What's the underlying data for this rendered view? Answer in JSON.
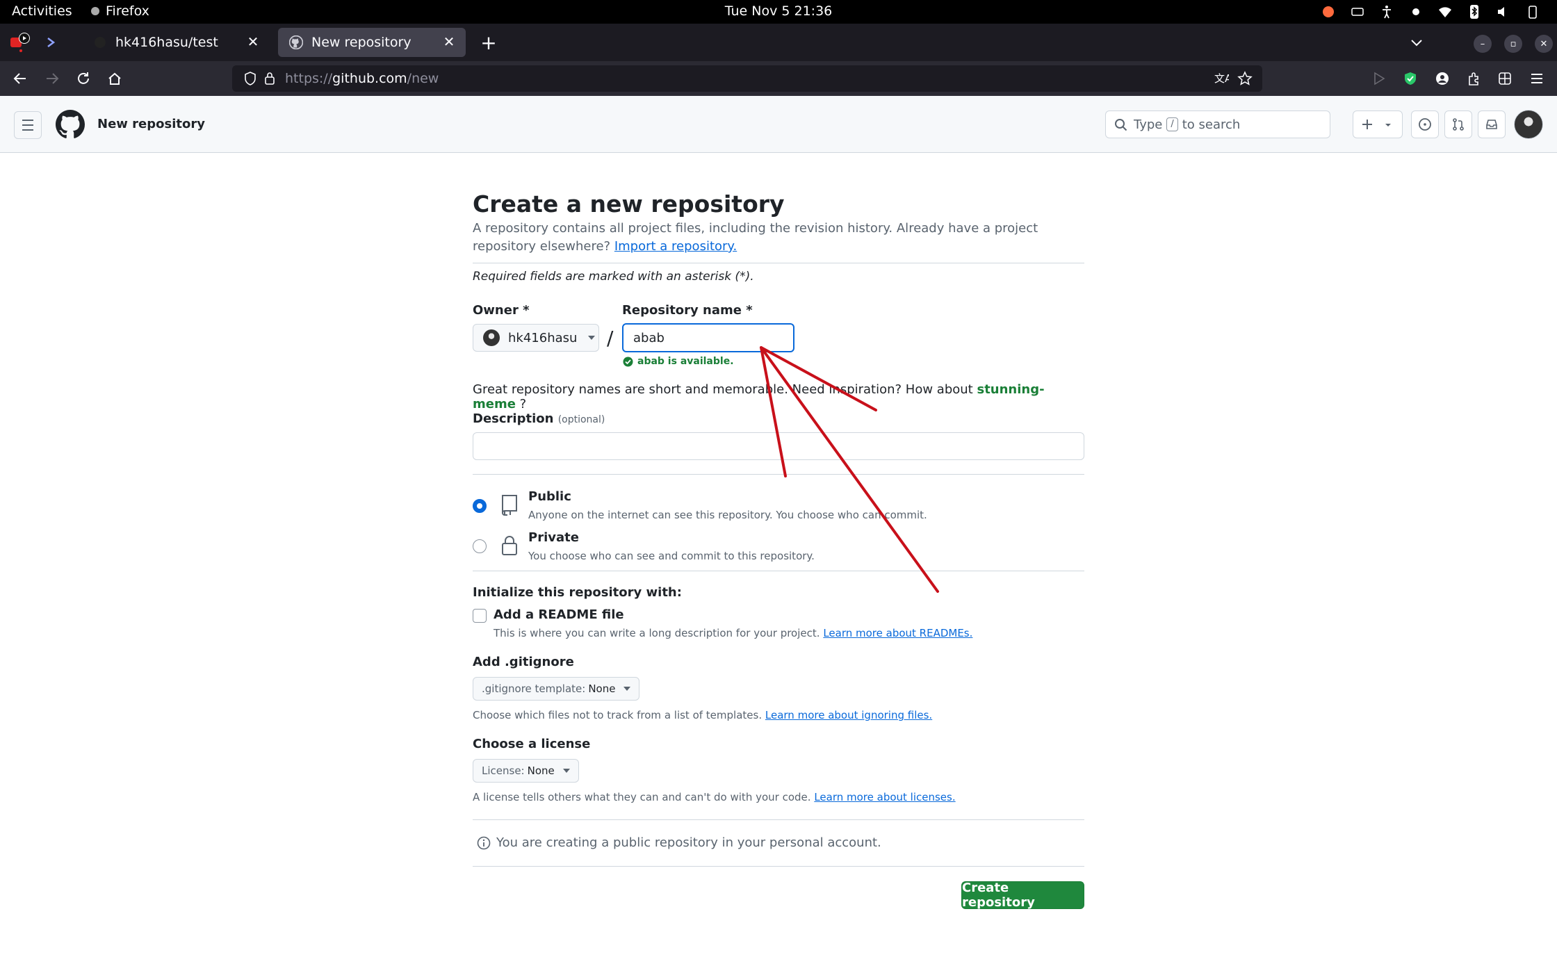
{
  "os_topbar": {
    "activities": "Activities",
    "app_name": "Firefox",
    "clock": "Tue Nov 5  21:36"
  },
  "browser": {
    "tabs": [
      {
        "title": "hk416hasu/test",
        "active": false
      },
      {
        "title": "New repository",
        "active": true
      }
    ],
    "url_prefix": "https://",
    "url_host": "github.com",
    "url_path": "/new"
  },
  "github_header": {
    "page_label": "New repository",
    "search_prefix": "Type",
    "search_key": "/",
    "search_suffix": "to search"
  },
  "form": {
    "title": "Create a new repository",
    "intro": "A repository contains all project files, including the revision history. Already have a project repository elsewhere?",
    "import_link": "Import a repository.",
    "required_note": "Required fields are marked with an asterisk (*).",
    "owner_label": "Owner *",
    "owner_value": "hk416hasu",
    "slash": "/",
    "repo_name_label": "Repository name *",
    "repo_name_value": "abab",
    "availability": "abab is available.",
    "suggestion_prefix": "Great repository names are short and memorable. Need inspiration? How about",
    "suggestion_name": "stunning-meme",
    "suggestion_suffix": "?",
    "description_label": "Description",
    "description_optional": "(optional)",
    "description_value": "",
    "visibility": {
      "public_title": "Public",
      "public_desc": "Anyone on the internet can see this repository. You choose who can commit.",
      "private_title": "Private",
      "private_desc": "You choose who can see and commit to this repository.",
      "selected": "public"
    },
    "init_label": "Initialize this repository with:",
    "readme_label": "Add a README file",
    "readme_desc": "This is where you can write a long description for your project.",
    "readme_link": "Learn more about READMEs.",
    "gitignore_label": "Add .gitignore",
    "gitignore_prefix": ".gitignore template:",
    "gitignore_value": "None",
    "gitignore_desc": "Choose which files not to track from a list of templates.",
    "gitignore_link": "Learn more about ignoring files.",
    "license_label": "Choose a license",
    "license_prefix": "License:",
    "license_value": "None",
    "license_desc": "A license tells others what they can and can't do with your code.",
    "license_link": "Learn more about licenses.",
    "notice": "You are creating a public repository in your personal account.",
    "create_button": "Create repository"
  },
  "colors": {
    "accent": "#0969da",
    "success": "#1a7f37",
    "create_button": "#1f883d",
    "annotation_arrow": "#c8101a"
  }
}
